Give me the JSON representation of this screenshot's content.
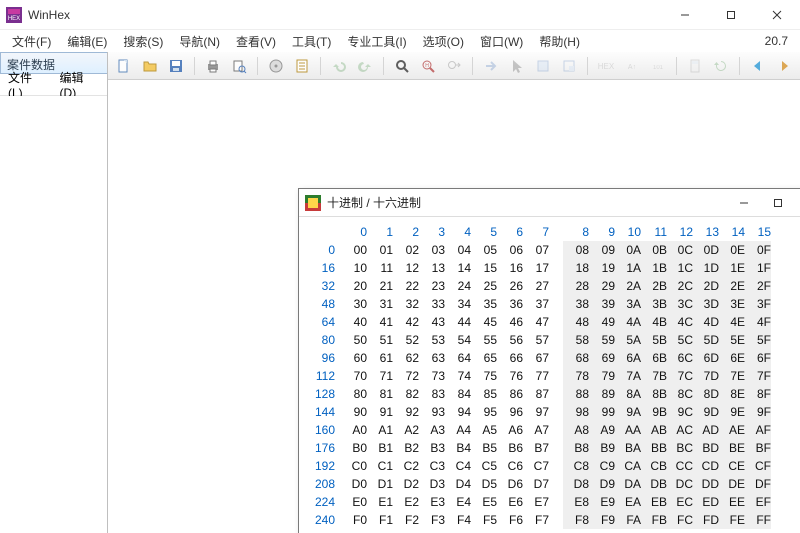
{
  "title": "WinHex",
  "version": "20.7",
  "menu": [
    "文件(F)",
    "编辑(E)",
    "搜索(S)",
    "导航(N)",
    "查看(V)",
    "工具(T)",
    "专业工具(I)",
    "选项(O)",
    "窗口(W)",
    "帮助(H)"
  ],
  "sidebar": {
    "header": "案件数据",
    "tabs": [
      "文件(L)",
      "编辑(D)"
    ]
  },
  "dialog": {
    "title": "十进制 / 十六进制",
    "cols": [
      "0",
      "1",
      "2",
      "3",
      "4",
      "5",
      "6",
      "7",
      "8",
      "9",
      "10",
      "11",
      "12",
      "13",
      "14",
      "15"
    ],
    "rows": [
      {
        "off": "0",
        "c": [
          "00",
          "01",
          "02",
          "03",
          "04",
          "05",
          "06",
          "07",
          "08",
          "09",
          "0A",
          "0B",
          "0C",
          "0D",
          "0E",
          "0F"
        ]
      },
      {
        "off": "16",
        "c": [
          "10",
          "11",
          "12",
          "13",
          "14",
          "15",
          "16",
          "17",
          "18",
          "19",
          "1A",
          "1B",
          "1C",
          "1D",
          "1E",
          "1F"
        ]
      },
      {
        "off": "32",
        "c": [
          "20",
          "21",
          "22",
          "23",
          "24",
          "25",
          "26",
          "27",
          "28",
          "29",
          "2A",
          "2B",
          "2C",
          "2D",
          "2E",
          "2F"
        ]
      },
      {
        "off": "48",
        "c": [
          "30",
          "31",
          "32",
          "33",
          "34",
          "35",
          "36",
          "37",
          "38",
          "39",
          "3A",
          "3B",
          "3C",
          "3D",
          "3E",
          "3F"
        ]
      },
      {
        "off": "64",
        "c": [
          "40",
          "41",
          "42",
          "43",
          "44",
          "45",
          "46",
          "47",
          "48",
          "49",
          "4A",
          "4B",
          "4C",
          "4D",
          "4E",
          "4F"
        ]
      },
      {
        "off": "80",
        "c": [
          "50",
          "51",
          "52",
          "53",
          "54",
          "55",
          "56",
          "57",
          "58",
          "59",
          "5A",
          "5B",
          "5C",
          "5D",
          "5E",
          "5F"
        ]
      },
      {
        "off": "96",
        "c": [
          "60",
          "61",
          "62",
          "63",
          "64",
          "65",
          "66",
          "67",
          "68",
          "69",
          "6A",
          "6B",
          "6C",
          "6D",
          "6E",
          "6F"
        ]
      },
      {
        "off": "112",
        "c": [
          "70",
          "71",
          "72",
          "73",
          "74",
          "75",
          "76",
          "77",
          "78",
          "79",
          "7A",
          "7B",
          "7C",
          "7D",
          "7E",
          "7F"
        ]
      },
      {
        "off": "128",
        "c": [
          "80",
          "81",
          "82",
          "83",
          "84",
          "85",
          "86",
          "87",
          "88",
          "89",
          "8A",
          "8B",
          "8C",
          "8D",
          "8E",
          "8F"
        ]
      },
      {
        "off": "144",
        "c": [
          "90",
          "91",
          "92",
          "93",
          "94",
          "95",
          "96",
          "97",
          "98",
          "99",
          "9A",
          "9B",
          "9C",
          "9D",
          "9E",
          "9F"
        ]
      },
      {
        "off": "160",
        "c": [
          "A0",
          "A1",
          "A2",
          "A3",
          "A4",
          "A5",
          "A6",
          "A7",
          "A8",
          "A9",
          "AA",
          "AB",
          "AC",
          "AD",
          "AE",
          "AF"
        ]
      },
      {
        "off": "176",
        "c": [
          "B0",
          "B1",
          "B2",
          "B3",
          "B4",
          "B5",
          "B6",
          "B7",
          "B8",
          "B9",
          "BA",
          "BB",
          "BC",
          "BD",
          "BE",
          "BF"
        ]
      },
      {
        "off": "192",
        "c": [
          "C0",
          "C1",
          "C2",
          "C3",
          "C4",
          "C5",
          "C6",
          "C7",
          "C8",
          "C9",
          "CA",
          "CB",
          "CC",
          "CD",
          "CE",
          "CF"
        ]
      },
      {
        "off": "208",
        "c": [
          "D0",
          "D1",
          "D2",
          "D3",
          "D4",
          "D5",
          "D6",
          "D7",
          "D8",
          "D9",
          "DA",
          "DB",
          "DC",
          "DD",
          "DE",
          "DF"
        ]
      },
      {
        "off": "224",
        "c": [
          "E0",
          "E1",
          "E2",
          "E3",
          "E4",
          "E5",
          "E6",
          "E7",
          "E8",
          "E9",
          "EA",
          "EB",
          "EC",
          "ED",
          "EE",
          "EF"
        ]
      },
      {
        "off": "240",
        "c": [
          "F0",
          "F1",
          "F2",
          "F3",
          "F4",
          "F5",
          "F6",
          "F7",
          "F8",
          "F9",
          "FA",
          "FB",
          "FC",
          "FD",
          "FE",
          "FF"
        ]
      }
    ]
  },
  "toolbar_icons": [
    "new-file",
    "open-folder",
    "save",
    "spacer",
    "print",
    "print-preview",
    "spacer",
    "open-disk",
    "properties",
    "spacer",
    "undo",
    "redo",
    "spacer",
    "find",
    "find-hex",
    "find-next",
    "spacer",
    "goto",
    "cursor",
    "block",
    "block-end",
    "spacer",
    "hex-mode",
    "text-mode",
    "bits",
    "spacer",
    "calc",
    "refresh",
    "spacer",
    "back",
    "forward"
  ]
}
